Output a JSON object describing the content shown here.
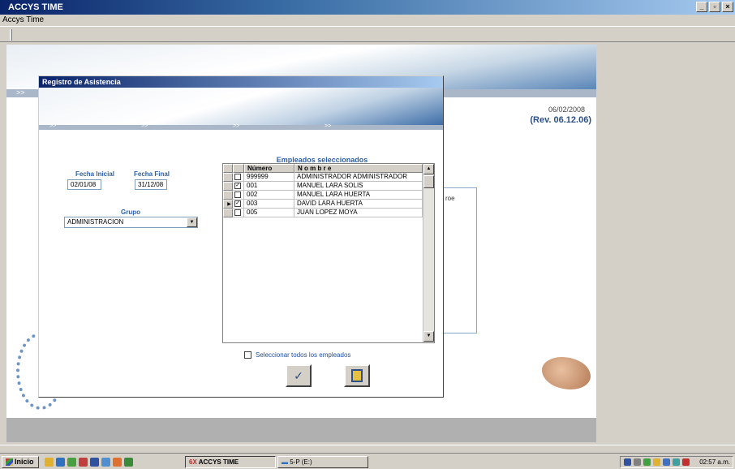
{
  "window": {
    "title": "ACCYS TIME",
    "menu": "Accys Time"
  },
  "workspace": {
    "nav_arrows": ">>",
    "date": "06/02/2008",
    "revision": "(Rev. 06.12.06)",
    "panel_text": "roe"
  },
  "dialog": {
    "title": "Registro de Asistencia",
    "nav": [
      ">>",
      ">>",
      ">>",
      ">>"
    ],
    "fecha_inicial_label": "Fecha Inicial",
    "fecha_inicial_value": "02/01/08",
    "fecha_final_label": "Fecha Final",
    "fecha_final_value": "31/12/08",
    "grupo_label": "Grupo",
    "grupo_value": "ADMINISTRACION",
    "grid_title": "Empleados seleccionados",
    "columns": [
      "Número",
      "N o m b r e"
    ],
    "rows": [
      {
        "numero": "999999",
        "nombre": "ADMINISTRADOR ADMINISTRADOR",
        "checked": false,
        "current": false
      },
      {
        "numero": "001",
        "nombre": "MANUEL LARA SOLIS",
        "checked": true,
        "current": false
      },
      {
        "numero": "002",
        "nombre": "MANUEL LARA HUERTA",
        "checked": false,
        "current": false
      },
      {
        "numero": "003",
        "nombre": "DAVID LARA HUERTA",
        "checked": true,
        "current": true
      },
      {
        "numero": "005",
        "nombre": "JUAN LOPEZ MOYA",
        "checked": false,
        "current": false
      }
    ],
    "select_all_label": "Seleccionar todos los empleados",
    "accept_icon": "checkmark-icon",
    "exit_icon": "exit-door-icon"
  },
  "taskbar": {
    "start_label": "Inicio",
    "buttons": [
      {
        "label": "ACCYS TIME",
        "prefix": "6X"
      },
      {
        "label": "5-P (E:)"
      }
    ],
    "clock": "02:57 a.m."
  },
  "colors": {
    "title_bar": "#0a246a",
    "accent_blue": "#2b5fa8",
    "revision": "#2b4f86"
  }
}
